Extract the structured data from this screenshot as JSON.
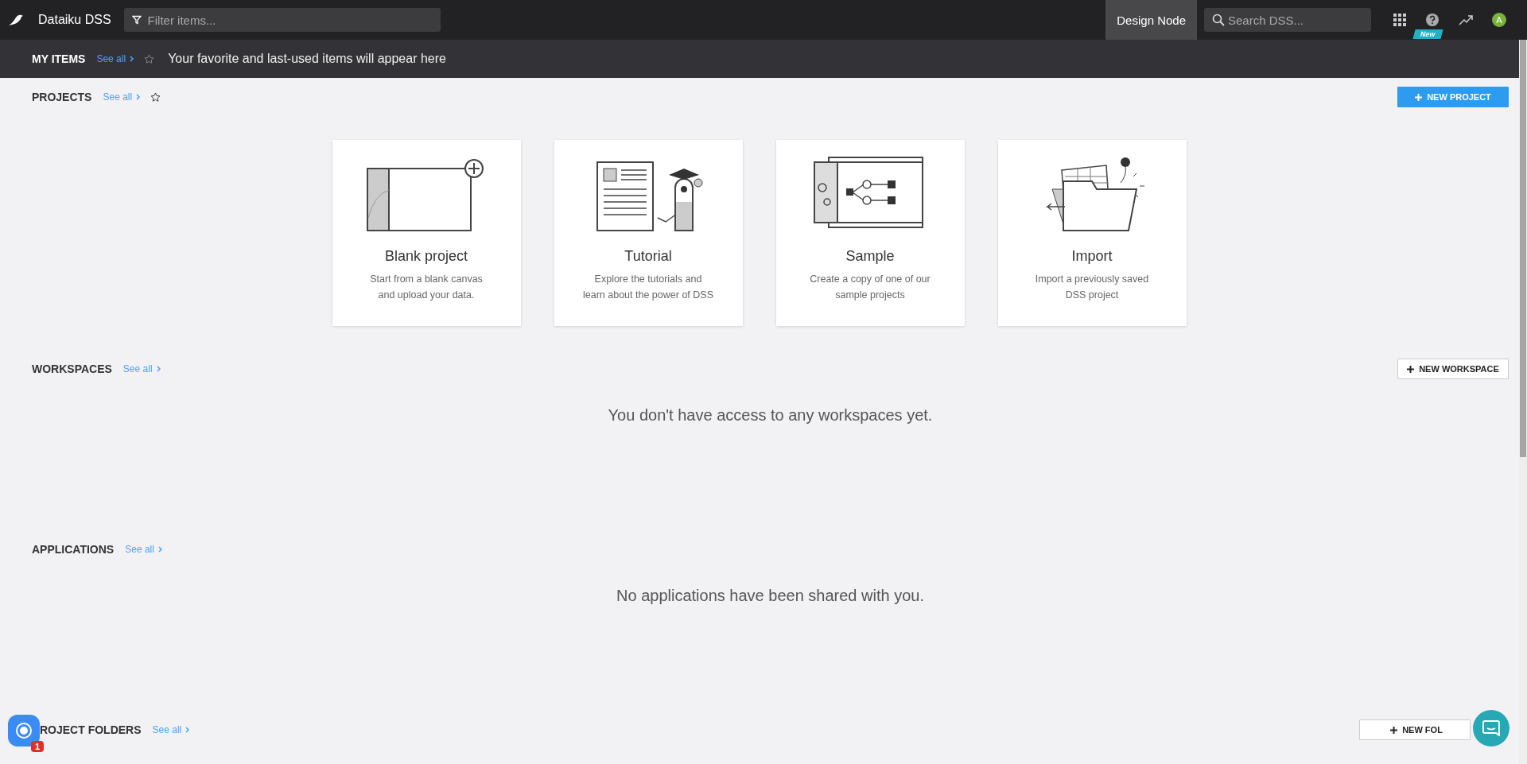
{
  "topbar": {
    "app_name": "Dataiku DSS",
    "filter": {
      "placeholder": "Filter items..."
    },
    "node_label": "Design Node",
    "search": {
      "placeholder": "Search DSS..."
    },
    "new_badge": "New",
    "avatar": "A"
  },
  "my_items": {
    "title": "MY ITEMS",
    "see_all": "See all",
    "message": "Your favorite and last-used items will appear here"
  },
  "sections": [
    {
      "kind": "projects",
      "title": "PROJECTS",
      "see_all": "See all",
      "star": true,
      "button": "NEW PROJECT",
      "primary": true,
      "cards": [
        {
          "kind": "blank",
          "title": "Blank project",
          "lines": [
            "Start from a blank canvas",
            "and upload your data."
          ]
        },
        {
          "kind": "tutorial",
          "title": "Tutorial",
          "lines": [
            "Explore the tutorials and",
            "learn about the power of DSS"
          ]
        },
        {
          "kind": "sample",
          "title": "Sample",
          "lines": [
            "Create a copy of one of our",
            "sample projects"
          ]
        },
        {
          "kind": "import",
          "title": "Import",
          "lines": [
            "Import a previously saved",
            "DSS project"
          ]
        }
      ]
    },
    {
      "kind": "empty",
      "title": "WORKSPACES",
      "see_all": "See all",
      "star": false,
      "button": "NEW WORKSPACE",
      "primary": false,
      "message": "You don't have access to any workspaces yet."
    },
    {
      "kind": "empty",
      "title": "APPLICATIONS",
      "see_all": "See all",
      "star": false,
      "message": "No applications have been shared with you."
    },
    {
      "kind": "folders",
      "title": "ROJECT FOLDERS",
      "see_all": "See all",
      "star": false,
      "button": "NEW FOL",
      "primary": false
    }
  ],
  "notification_count": "1"
}
